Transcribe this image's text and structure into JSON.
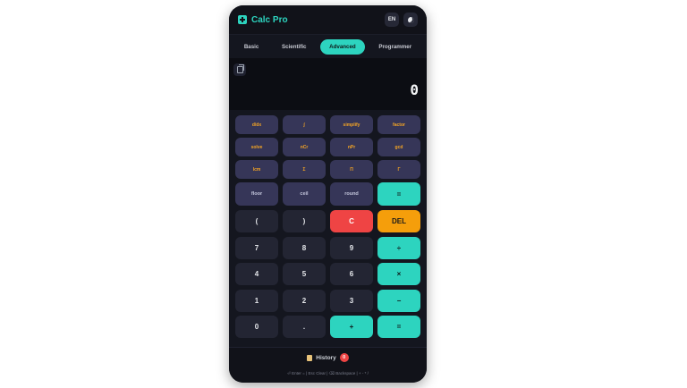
{
  "app": {
    "title": "Calc Pro"
  },
  "header": {
    "lang_label": "EN"
  },
  "tabs": [
    {
      "label": "Basic"
    },
    {
      "label": "Scientific"
    },
    {
      "label": "Advanced",
      "active": true
    },
    {
      "label": "Programmer"
    }
  ],
  "display": {
    "value": "0"
  },
  "function_keys": [
    "d/dx",
    "∫",
    "simplify",
    "factor",
    "solve",
    "nCr",
    "nPr",
    "gcd",
    "lcm",
    "Σ",
    "Π",
    "Γ"
  ],
  "row4": [
    "floor",
    "ceil",
    "round",
    "="
  ],
  "row5": [
    "(",
    ")",
    "C",
    "DEL"
  ],
  "keypad": {
    "r1": [
      "7",
      "8",
      "9",
      "÷"
    ],
    "r2": [
      "4",
      "5",
      "6",
      "×"
    ],
    "r3": [
      "1",
      "2",
      "3",
      "−"
    ],
    "r4": [
      "0",
      ".",
      "+",
      "="
    ]
  },
  "footer": {
    "history_label": "History",
    "history_count": "0",
    "hint": "⏎ Enter = | Esc Clear | ⌫ Backspace | + - * /"
  },
  "colors": {
    "accent": "#2dd4bf",
    "clear": "#ef4444",
    "delete": "#f59e0b",
    "function_bg": "#363658",
    "function_text": "#f5a524"
  }
}
